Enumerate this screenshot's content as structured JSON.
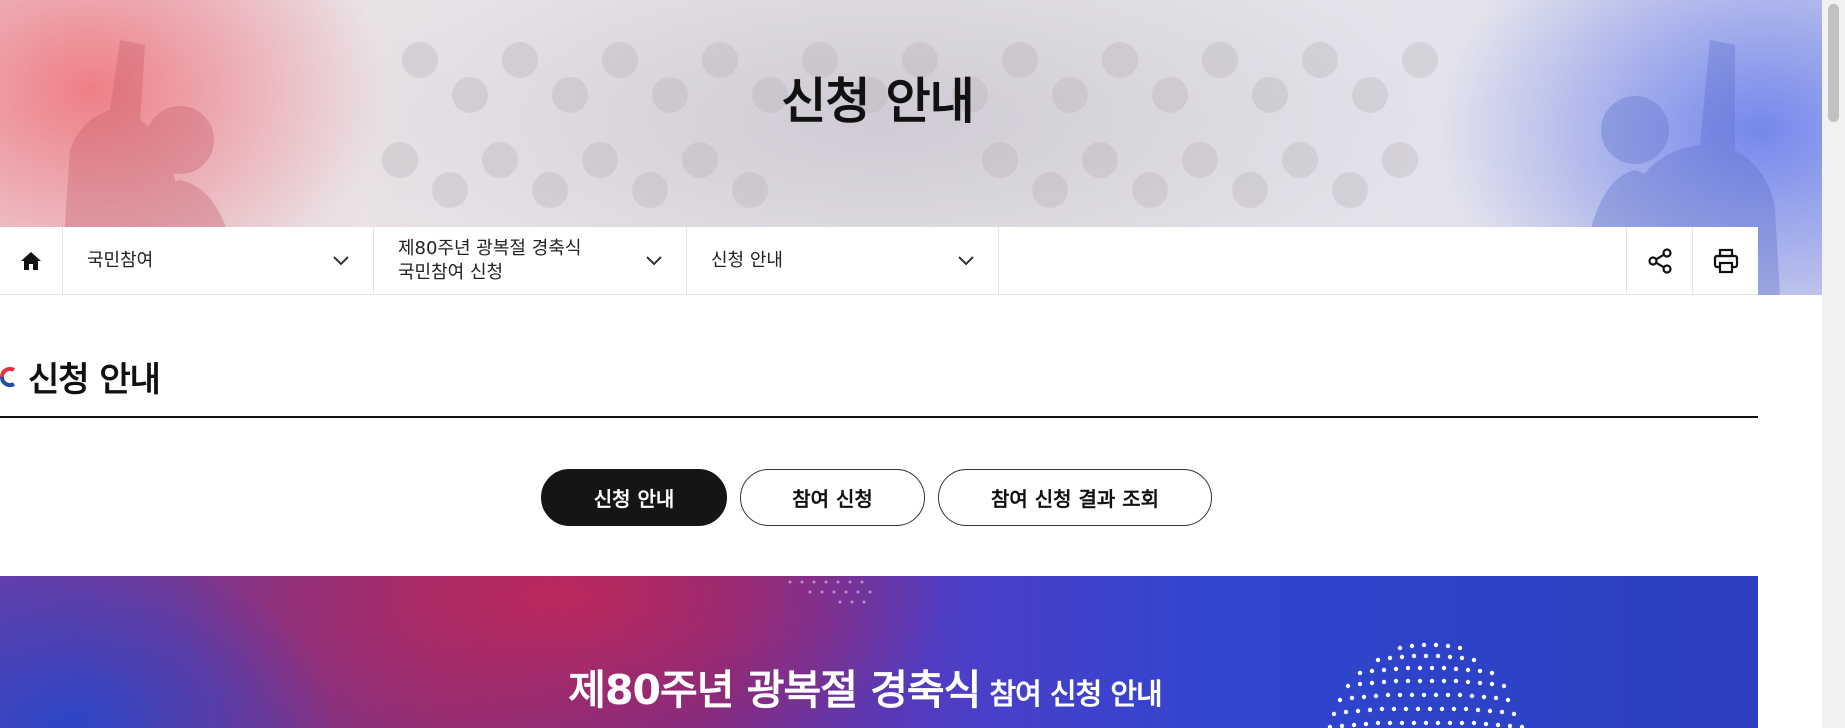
{
  "hero": {
    "title": "신청 안내"
  },
  "subnav": {
    "home_icon": "home-icon",
    "items": [
      {
        "line1": "국민참여",
        "line2": ""
      },
      {
        "line1": "제80주년 광복절 경축식",
        "line2": "국민참여 신청"
      },
      {
        "line1": "신청 안내",
        "line2": ""
      }
    ],
    "share_icon": "share-icon",
    "print_icon": "print-icon"
  },
  "section": {
    "title": "신청 안내"
  },
  "tabs": [
    {
      "label": "신청 안내",
      "active": true
    },
    {
      "label": "참여 신청",
      "active": false
    },
    {
      "label": "참여 신청 결과 조회",
      "active": false
    }
  ],
  "banner": {
    "title_main": "제80주년 광복절 경축식",
    "title_sub": "참여 신청 안내"
  },
  "colors": {
    "accent_red": "#e2343c",
    "accent_blue": "#1f4fa8",
    "tab_active_bg": "#151515"
  }
}
